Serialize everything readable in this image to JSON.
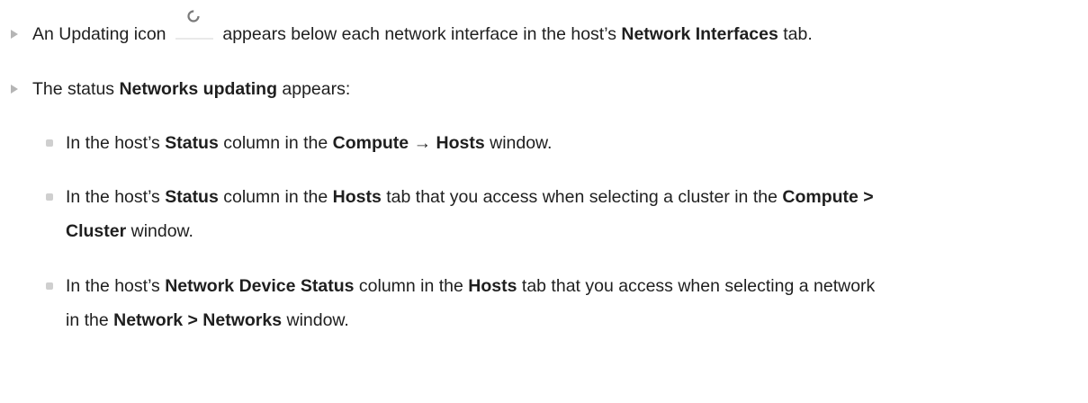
{
  "items": [
    {
      "t1": "An Updating icon",
      "icon": "updating-icon",
      "t2": " appears below each network interface in the host’s ",
      "b1": "Network Interfaces",
      "t3": " tab."
    },
    {
      "t1": "The status ",
      "b1": "Networks updating",
      "t2": " appears:"
    }
  ],
  "sub_items": [
    {
      "t1": "In the host’s ",
      "b1": "Status",
      "t2": " column in the ",
      "b2": "Compute",
      "t3": " → ",
      "b3": "Hosts",
      "t4": " window."
    },
    {
      "line1": {
        "t1": "In the host’s ",
        "b1": "Status",
        "t2": " column in the ",
        "b2": "Hosts",
        "t3": " tab that you access when selecting a cluster in the ",
        "b3": "Compute >"
      },
      "line2": {
        "b1": "Cluster",
        "t1": " window."
      }
    },
    {
      "line1": {
        "t1": "In the host’s ",
        "b1": "Network Device Status",
        "t2": " column in the ",
        "b2": "Hosts",
        "t3": " tab that you access when selecting a network"
      },
      "line2": {
        "t1": "in the ",
        "b1": "Network > Networks",
        "t2": " window."
      }
    }
  ]
}
